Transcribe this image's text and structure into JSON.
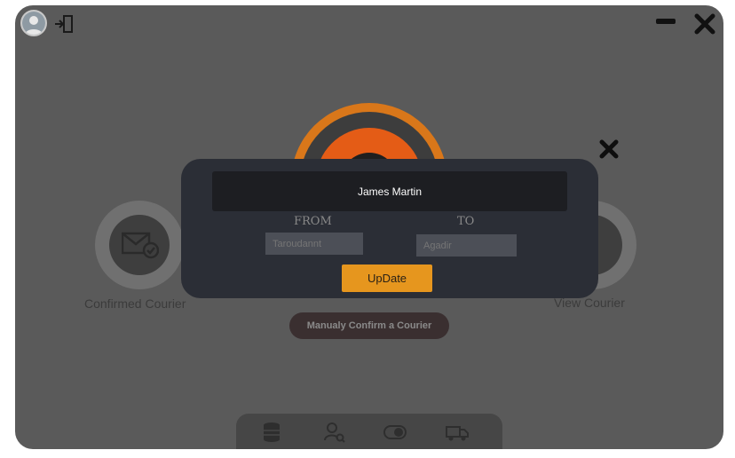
{
  "app": {
    "accent_color": "#e6961e",
    "icons": {
      "avatar": "user-avatar-icon",
      "logout": "logout-icon",
      "minimize": "minimize-icon",
      "close": "close-icon"
    }
  },
  "dashboard": {
    "confirmed_label": "Confirmed Courier",
    "view_label": "View Courier",
    "manual_confirm_label": "Manualy Confirm a  Courier",
    "bottom_icons": [
      "database-icon",
      "user-search-icon",
      "toggle-icon",
      "truck-icon"
    ]
  },
  "modal": {
    "name": "James Martin",
    "from_label": "FROM",
    "to_label": "TO",
    "from_value": "Taroudannt",
    "to_value": "Agadir",
    "update_label": "UpDate"
  }
}
